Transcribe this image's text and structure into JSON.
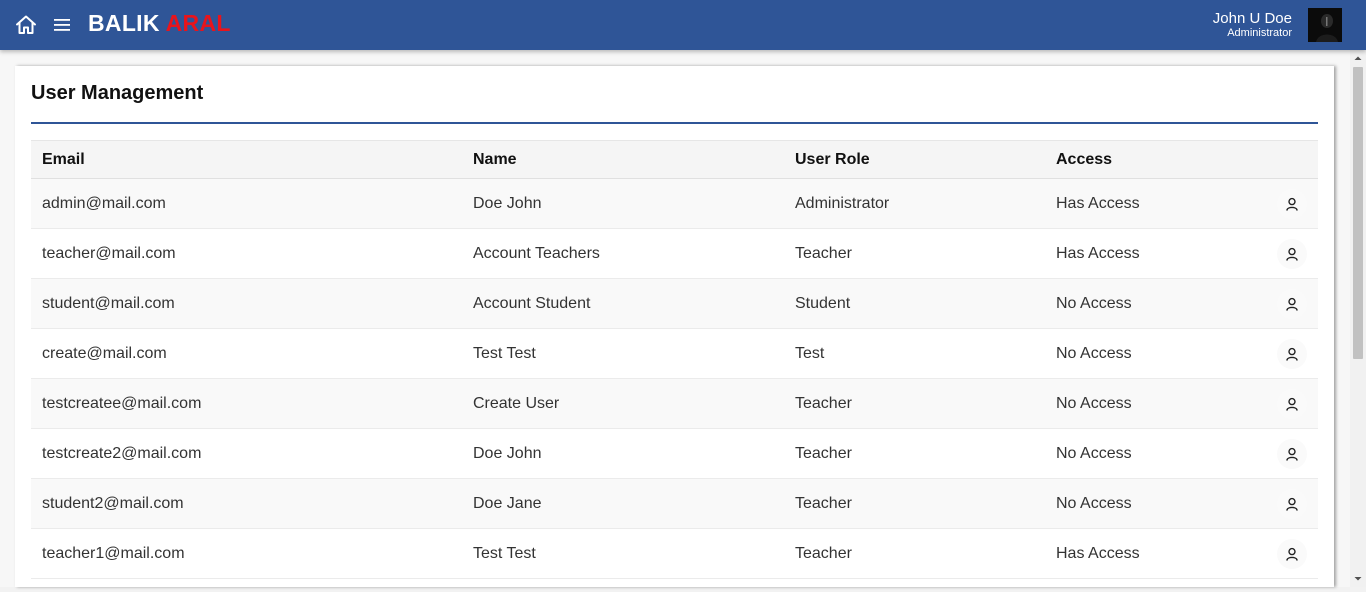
{
  "header": {
    "brand_part1": "BALIK",
    "brand_part2": "ARAL",
    "user_name": "John U Doe",
    "user_role": "Administrator",
    "home_icon": "home-icon",
    "menu_icon": "hamburger-menu-icon",
    "brand_accent_color": "#e8141c",
    "bar_color": "#2f5597"
  },
  "page": {
    "title": "User Management"
  },
  "table": {
    "columns": [
      "Email",
      "Name",
      "User Role",
      "Access"
    ],
    "row_action_icon": "user-icon",
    "rows": [
      {
        "email": "admin@mail.com",
        "name": "Doe John",
        "role": "Administrator",
        "access": "Has Access"
      },
      {
        "email": "teacher@mail.com",
        "name": "Account Teachers",
        "role": "Teacher",
        "access": "Has Access"
      },
      {
        "email": "student@mail.com",
        "name": "Account Student",
        "role": "Student",
        "access": "No Access"
      },
      {
        "email": "create@mail.com",
        "name": "Test Test",
        "role": "Test",
        "access": "No Access"
      },
      {
        "email": "testcreatee@mail.com",
        "name": "Create User",
        "role": "Teacher",
        "access": "No Access"
      },
      {
        "email": "testcreate2@mail.com",
        "name": "Doe John",
        "role": "Teacher",
        "access": "No Access"
      },
      {
        "email": "student2@mail.com",
        "name": "Doe Jane",
        "role": "Teacher",
        "access": "No Access"
      },
      {
        "email": "teacher1@mail.com",
        "name": "Test Test",
        "role": "Teacher",
        "access": "Has Access"
      }
    ]
  }
}
